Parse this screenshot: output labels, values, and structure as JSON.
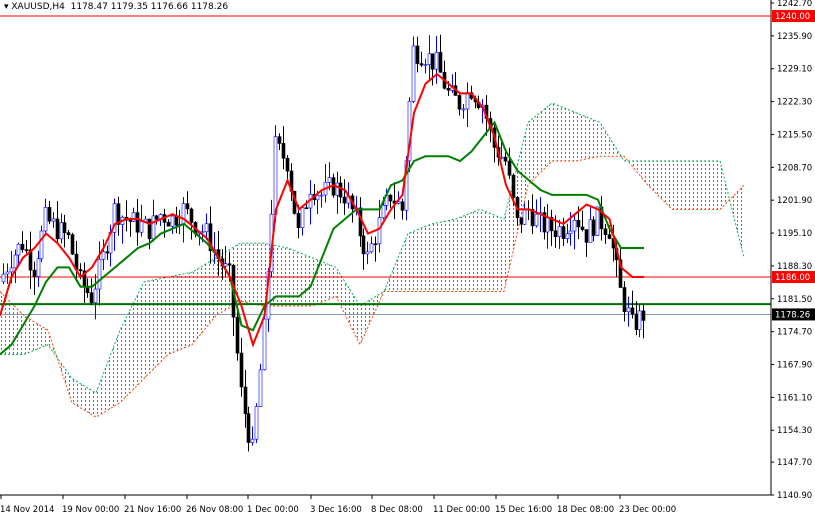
{
  "header": {
    "symbol": "XAUUSD,H4",
    "ohlc": "1178.47 1179.35 1176.66 1178.26"
  },
  "chart_data": {
    "type": "candlestick",
    "symbol": "XAUUSD",
    "timeframe": "H4",
    "ylim": [
      1140.9,
      1242.7
    ],
    "y_ticks": [
      "1242.70",
      "1235.90",
      "1229.10",
      "1222.30",
      "1215.50",
      "1208.70",
      "1201.90",
      "1195.10",
      "1188.30",
      "1181.50",
      "1174.70",
      "1167.90",
      "1161.10",
      "1154.30",
      "1147.70",
      "1140.90"
    ],
    "x_ticks": [
      "14 Nov 2014",
      "19 Nov 00:00",
      "21 Nov 16:00",
      "26 Nov 08:00",
      "1 Dec 00:00",
      "3 Dec 16:00",
      "8 Dec 08:00",
      "11 Dec 00:00",
      "15 Dec 16:00",
      "18 Dec 08:00",
      "23 Dec 00:00"
    ],
    "closes": [
      1185,
      1190,
      1193,
      1188,
      1198,
      1196,
      1194,
      1185,
      1182,
      1190,
      1200,
      1198,
      1197,
      1196,
      1199,
      1198,
      1200,
      1197,
      1195,
      1190,
      1186,
      1162,
      1150,
      1175,
      1213,
      1210,
      1195,
      1205,
      1203,
      1205,
      1203,
      1198,
      1190,
      1197,
      1203,
      1200,
      1233,
      1232,
      1230,
      1224,
      1222,
      1225,
      1222,
      1213,
      1210,
      1197,
      1200,
      1197,
      1196,
      1196,
      1199,
      1195,
      1198,
      1196,
      1183,
      1176,
      1178.26
    ],
    "tenkan": [
      1178,
      1186,
      1190,
      1192,
      1195,
      1193,
      1190,
      1186,
      1188,
      1192,
      1197,
      1198,
      1198,
      1197,
      1198,
      1199,
      1198,
      1196,
      1194,
      1190,
      1186,
      1180,
      1172,
      1178,
      1200,
      1206,
      1200,
      1202,
      1204,
      1205,
      1204,
      1200,
      1195,
      1196,
      1200,
      1203,
      1220,
      1226,
      1228,
      1226,
      1224,
      1224,
      1221,
      1215,
      1205,
      1200,
      1200,
      1199,
      1198,
      1197,
      1199,
      1201,
      1200,
      1198,
      1188,
      1186,
      1186
    ],
    "kijun": [
      1170,
      1172,
      1176,
      1180,
      1185,
      1188,
      1188,
      1184,
      1184,
      1186,
      1188,
      1190,
      1192,
      1193,
      1195,
      1196,
      1197,
      1195,
      1193,
      1190,
      1186,
      1176,
      1175,
      1180,
      1182,
      1182,
      1182,
      1184,
      1190,
      1196,
      1198,
      1200,
      1200,
      1200,
      1205,
      1206,
      1210,
      1211,
      1211,
      1211,
      1210,
      1212,
      1215,
      1218,
      1212,
      1208,
      1206,
      1204,
      1203,
      1203,
      1203,
      1203,
      1202,
      1196,
      1192,
      1192,
      1192
    ],
    "senkou_a": [
      1170,
      1170,
      1172,
      1165,
      1162,
      1175,
      1185,
      1186,
      1187,
      1190,
      1193,
      1193,
      1192,
      1190,
      1188,
      1180,
      1183,
      1195,
      1197,
      1198,
      1200,
      1198,
      1218,
      1222,
      1220,
      1218,
      1210,
      1210,
      1210,
      1210,
      1210,
      1190
    ],
    "senkou_b": [
      1183,
      1178,
      1175,
      1160,
      1157,
      1160,
      1165,
      1170,
      1172,
      1178,
      1181,
      1180,
      1180,
      1180,
      1182,
      1172,
      1183,
      1183,
      1183,
      1183,
      1183,
      1183,
      1205,
      1210,
      1210,
      1211,
      1211,
      1205,
      1200,
      1200,
      1200,
      1205
    ],
    "levels": [
      {
        "price": 1240.0,
        "label": "1240.00",
        "color": "#ff0000"
      },
      {
        "price": 1186.0,
        "label": "1186.00",
        "color": "#ff0000"
      },
      {
        "price": 1180.4,
        "label": "",
        "color": "#007000"
      }
    ],
    "bid": {
      "price": 1178.26,
      "label": "1178.26"
    }
  },
  "colors": {
    "tenkan": "#ff0000",
    "kijun": "#008000",
    "bull_cloud": "#00b050",
    "bear_cloud": "#ff4000"
  }
}
